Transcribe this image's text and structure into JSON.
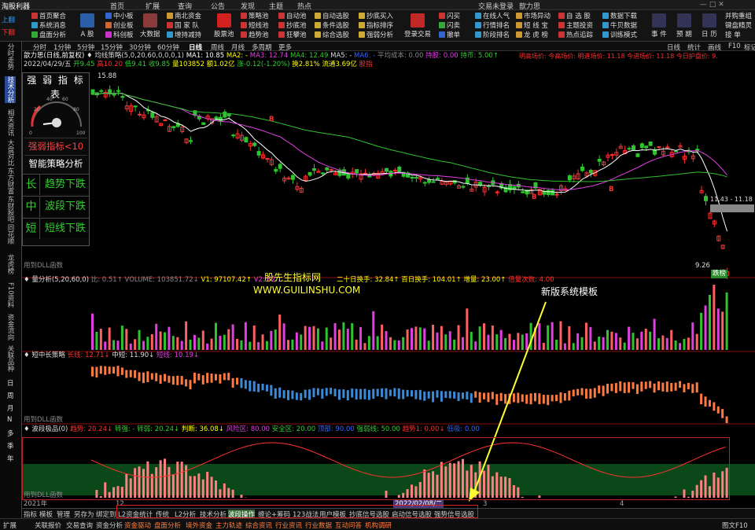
{
  "app": {
    "title": "淘股利器",
    "stock_name_title": "交易未登录",
    "stock_short": "歆力思"
  },
  "topmenu": [
    "首页",
    "扩展",
    "查询",
    "公告",
    "发现",
    "主题",
    "热点"
  ],
  "toolbar": {
    "left_items": [
      "上翻",
      "下翻"
    ],
    "col1": [
      "首页聚合",
      "系统消息",
      "盘面分析"
    ],
    "col2": [
      "中小板",
      "创业板",
      "科创板"
    ],
    "col3": [
      "南北资金",
      "国 家 队",
      "增持减持"
    ],
    "big1": "大数据",
    "big2": "股票池",
    "big3": "登录交易",
    "col4": [
      "策略池",
      "短线池",
      "趋势池"
    ],
    "col5": [
      "自动池",
      "抄底池",
      "狂攀池"
    ],
    "col6": [
      "自动选股",
      "条件选股",
      "综合选股"
    ],
    "col7": [
      "抄底买入",
      "指标排序",
      "强弱分析"
    ],
    "col8": [
      "闪买",
      "闪卖",
      "撤单"
    ],
    "col9": [
      "在线人气",
      "行情排名",
      "阶段排名"
    ],
    "col10": [
      "市场异动",
      "短 线 宝",
      "龙 虎 榜"
    ],
    "col11": [
      "自 选 股",
      "主题投资",
      "热点追踪"
    ],
    "col12": [
      "数据下载",
      "牛贝数据",
      "训练模式"
    ],
    "big4": "事 件",
    "big5": "预 期",
    "big6": "日 历",
    "right_col": [
      "并购重组",
      "键盘精灵",
      "接 单"
    ],
    "rt_items": [
      "文",
      "委",
      "扩"
    ]
  },
  "left_tabs": [
    "分时走势",
    "技术分析",
    "相关资讯",
    "大盘对比",
    "东方财富",
    "东财股吧",
    "同花顺",
    "龙虎榜",
    "F10资料",
    "资金流向",
    "关联品种"
  ],
  "period_tabs": [
    "分时",
    "1分钟",
    "5分钟",
    "15分钟",
    "30分钟",
    "60分钟",
    "日线",
    "周线",
    "月线",
    "多周期",
    "更多"
  ],
  "price_panel": {
    "title": "歆力思(日线,前复权)",
    "ma_label": "♦ 均线策略(5,0,20,60,0,0,0,1)",
    "ma1": "MA1: 10.85",
    "ma2": "MA2: -",
    "ma3": "MA3: 12.74",
    "ma4": "MA4: 12.49",
    "ma5": "MA5: -",
    "ma6": "MA6: -",
    "avg": "平均成本: 0.00",
    "pos": "持股: 0.00",
    "fund": "持币: 5.00↑",
    "warn": "明高场价: 今高场价: 明进场价: 11.18 今进场价: 11.18 今日护盘价: 9.",
    "date_line": "2022/04/29/五",
    "open": "开9.45",
    "high": "高10.20",
    "low": "低9.41",
    "close": "收9.85",
    "vol": "量103852",
    "amount": "额1.02亿",
    "change": "涨-0.12(-1.20%)",
    "turn": "换2.81%",
    "mcap": "流通3.69亿",
    "tag": "股指",
    "price_top": "15.88",
    "price_low": "9.26",
    "range": "11.43 - 11.18",
    "note1": "用到DLL函数",
    "b1": "B",
    "b2": "B",
    "b3": "B",
    "wm_cn": "股先生指标网",
    "wm_en": "WWW.GUILINSHU.COM",
    "annot": "新版系统模板"
  },
  "strength": {
    "title": "强 弱 指 标 表",
    "gauge_min": "0",
    "gauge_max": "100",
    "gauge_ticks": [
      "20",
      "40",
      "60",
      "80"
    ],
    "row1": "强弱指标<10",
    "row2": "智能策略分析",
    "trend": [
      {
        "k": "长",
        "v": "趋势下跌"
      },
      {
        "k": "中",
        "v": "波段下跌"
      },
      {
        "k": "短",
        "v": "短线下跌"
      }
    ]
  },
  "vol_panel": {
    "title": "♦ 量分析(5,20,60,0)",
    "ratio": "比: 0.51↑",
    "volume": "VOLUME: 103851.72↓",
    "v1": "V1: 97107.42↑",
    "v2": "V2: 62...",
    "turn20": "二十日换手: 32.84↑",
    "turn100": "百日换手: 104.01↑",
    "inc": "增量: 23.00↑",
    "times": "倍量次数: 4.00"
  },
  "mid_panel": {
    "title": "♦ 短中长策略",
    "long": "长线: 12.71↓",
    "mid": "中短: 11.90↓",
    "short": "短线: 10.19↓",
    "note": "用到DLL函数"
  },
  "wave_panel": {
    "title": "♦ 波段极品(0)",
    "trend": "趋势: 20.24↓",
    "trans": "转强: -",
    "trans2": "转弱: 20.24↓",
    "judge": "判断: 36.08↓",
    "risk": "风险区: 80.00",
    "safe": "安全区: 20.00",
    "top": "顶部: 90.00",
    "strongweak": "强弱线: 50.00",
    "trend1": "趋势1: 0.00↓",
    "dip": "低吸: 0.00",
    "note": "用到DLL函数",
    "year": "2021年",
    "date_mark": "2022/02/08/二",
    "m3": "3",
    "m4": "4",
    "m12": "12"
  },
  "bottom_tabs1": [
    "指标",
    "模板",
    "管理",
    "另存为",
    "绑定到",
    "L2资金统计",
    "传统",
    "L2分析",
    "技术分析",
    "波段操作",
    "缠论+筹码",
    "123战法",
    "用户模板",
    "抄底信号选股",
    "启动信号选股",
    "强势信号选股"
  ],
  "bottom_tabs2": [
    "扩展",
    "关联报价",
    "交易查询",
    "资金分析",
    "资金驱动",
    "盘面分析",
    "境外资金",
    "主力轨迹",
    "综合资讯",
    "行业资讯",
    "行业数据",
    "互动问答",
    "机构调研"
  ],
  "bottom_right": "图文F10",
  "right_tabs": [
    "日线",
    "统计",
    "画线",
    "F10",
    "标记",
    "-"
  ],
  "colors": {
    "up": "#ff3030",
    "down": "#2fc42f",
    "ma_magenta": "#e040e0",
    "ma_green": "#30c030",
    "yellow": "#ffff30",
    "accent": "#e02020"
  },
  "chart_data": {
    "type": "candlestick",
    "x_range": [
      "2021",
      "2022/04/29"
    ],
    "ylim": [
      9.26,
      15.88
    ],
    "last_close": 9.85
  }
}
